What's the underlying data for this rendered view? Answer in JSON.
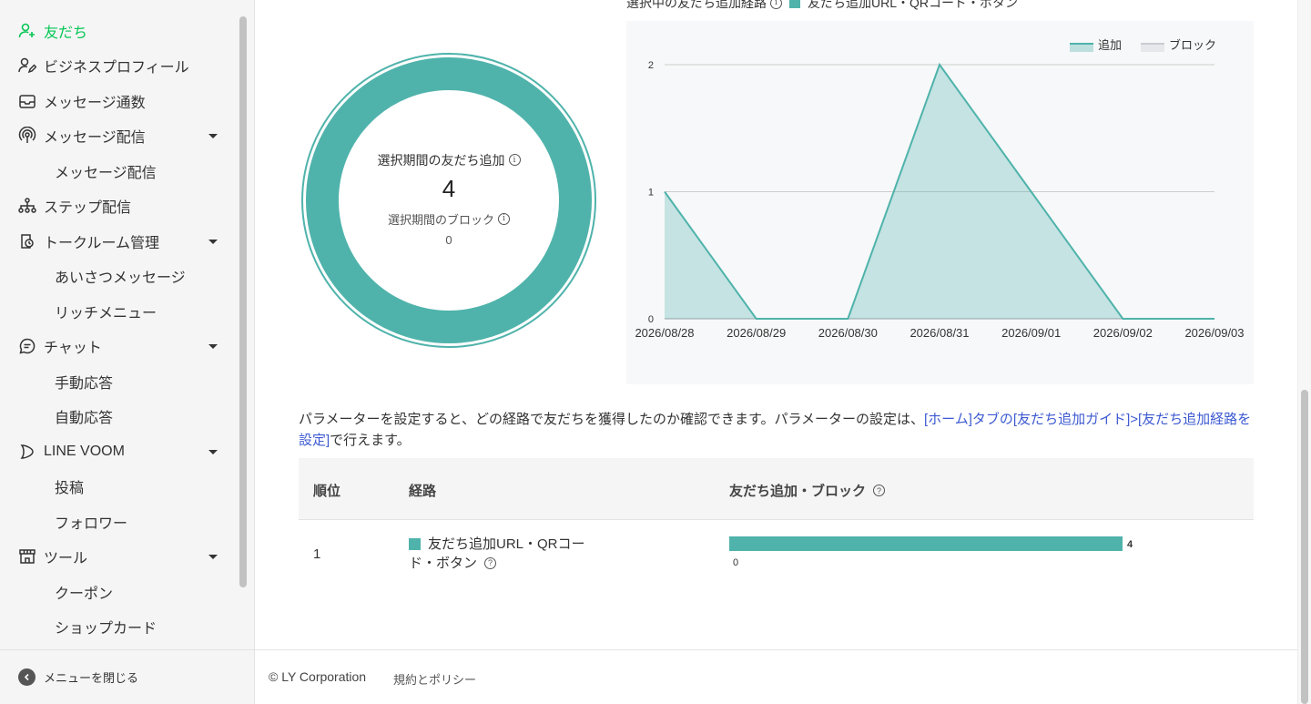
{
  "sidebar": {
    "items": [
      {
        "label": "友だち",
        "icon": "add-friend-icon",
        "active": true
      },
      {
        "label": "ビジネスプロフィール",
        "icon": "profile-edit-icon"
      },
      {
        "label": "メッセージ通数",
        "icon": "inbox-icon"
      },
      {
        "label": "メッセージ配信",
        "icon": "broadcast-icon",
        "caret": true
      },
      {
        "label": "メッセージ配信",
        "sub": true
      },
      {
        "label": "ステップ配信",
        "icon": "step-tree-icon"
      },
      {
        "label": "トークルーム管理",
        "icon": "talkroom-icon",
        "caret": true
      },
      {
        "label": "あいさつメッセージ",
        "sub": true
      },
      {
        "label": "リッチメニュー",
        "sub": true
      },
      {
        "label": "チャット",
        "icon": "chat-icon",
        "caret": true
      },
      {
        "label": "手動応答",
        "sub": true
      },
      {
        "label": "自動応答",
        "sub": true
      },
      {
        "label": "LINE VOOM",
        "icon": "voom-icon",
        "caret": true
      },
      {
        "label": "投稿",
        "sub": true
      },
      {
        "label": "フォロワー",
        "sub": true
      },
      {
        "label": "ツール",
        "icon": "tools-store-icon",
        "caret": true
      },
      {
        "label": "クーポン",
        "sub": true
      },
      {
        "label": "ショップカード",
        "sub": true
      }
    ],
    "close_menu_label": "メニューを閉じる"
  },
  "summary": {
    "route_label": "選択中の友だち追加経路",
    "route_name": "友だち追加URL・QRコード・ボタン",
    "added_label": "選択期間の友だち追加",
    "added_value": "4",
    "blocked_label": "選択期間のブロック",
    "blocked_value": "0"
  },
  "chart_data": {
    "type": "area",
    "x": [
      "2026/08/28",
      "2026/08/29",
      "2026/08/30",
      "2026/08/31",
      "2026/09/01",
      "2026/09/02",
      "2026/09/03"
    ],
    "series": [
      {
        "name": "追加",
        "values": [
          1,
          0,
          0,
          2,
          1,
          0,
          0
        ],
        "color": "#4fb3ab"
      },
      {
        "name": "ブロック",
        "values": [
          0,
          0,
          0,
          0,
          0,
          0,
          0
        ],
        "color": "#c9ccd1"
      }
    ],
    "ylim": [
      0,
      2
    ],
    "yticks": [
      "0",
      "1",
      "2"
    ],
    "legend": "top-right",
    "grid": true
  },
  "description": {
    "text": "パラメーターを設定すると、どの経路で友だちを獲得したのか確認できます。パラメーターの設定は、",
    "link": "[ホーム]タブの[友だち追加ガイド]>[友だち追加経路を設定]",
    "suffix": "で行えます。"
  },
  "table": {
    "headers": {
      "rank": "順位",
      "route": "経路",
      "metric": "友だち追加・ブロック"
    },
    "rows": [
      {
        "rank": "1",
        "route": "友だち追加URL・QRコー",
        "route_line2": "ド・ボタン",
        "added": "4",
        "blocked": "0",
        "added_fraction": 1.0
      }
    ]
  },
  "footer": {
    "copyright": "© LY Corporation",
    "policy": "規約とポリシー"
  },
  "colors": {
    "accent": "#4fb3ab",
    "active": "#06c755",
    "link": "#3d5ad1"
  }
}
